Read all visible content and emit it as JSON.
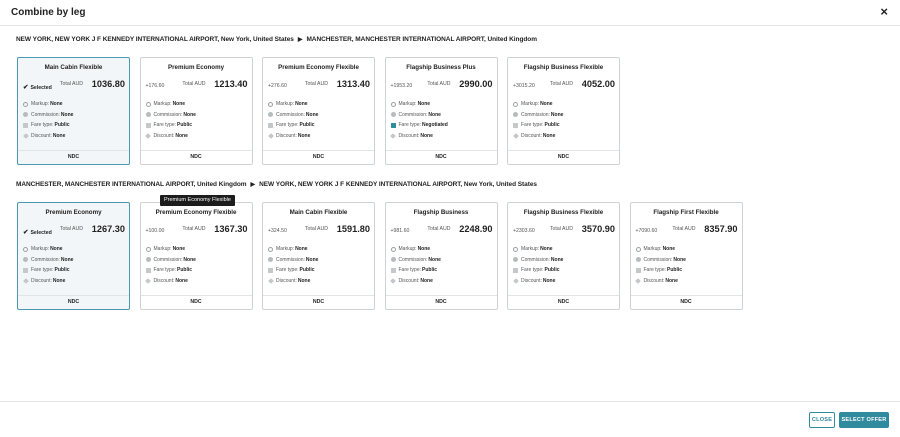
{
  "modal": {
    "title": "Combine by leg",
    "close_glyph": "×",
    "close_button": "CLOSE",
    "select_button": "SELECT OFFER"
  },
  "legs": [
    {
      "origin": "NEW YORK, NEW YORK J F KENNEDY INTERNATIONAL AIRPORT, New York, United States",
      "arrow": "▶",
      "destination": "MANCHESTER, MANCHESTER INTERNATIONAL AIRPORT, United Kingdom",
      "offers": [
        {
          "name": "Main Cabin Flexible",
          "selected": true,
          "diff": "Selected",
          "total_label": "Total AUD",
          "price": "1036.80",
          "markup_label": "Markup:",
          "markup": "None",
          "commission_label": "Commission:",
          "commission": "None",
          "fare_type_label": "Fare type:",
          "fare_type": "Public",
          "discount_label": "Discount:",
          "discount": "None",
          "source": "NDC",
          "negotiated": false
        },
        {
          "name": "Premium Economy",
          "selected": false,
          "diff": "+176.60",
          "total_label": "Total AUD",
          "price": "1213.40",
          "markup_label": "Markup:",
          "markup": "None",
          "commission_label": "Commission:",
          "commission": "None",
          "fare_type_label": "Fare type:",
          "fare_type": "Public",
          "discount_label": "Discount:",
          "discount": "None",
          "source": "NDC",
          "negotiated": false
        },
        {
          "name": "Premium Economy Flexible",
          "selected": false,
          "diff": "+276.60",
          "total_label": "Total AUD",
          "price": "1313.40",
          "markup_label": "Markup:",
          "markup": "None",
          "commission_label": "Commission:",
          "commission": "None",
          "fare_type_label": "Fare type:",
          "fare_type": "Public",
          "discount_label": "Discount:",
          "discount": "None",
          "source": "NDC",
          "negotiated": false
        },
        {
          "name": "Flagship Business Plus",
          "selected": false,
          "diff": "+1953.20",
          "total_label": "Total AUD",
          "price": "2990.00",
          "markup_label": "Markup:",
          "markup": "None",
          "commission_label": "Commission:",
          "commission": "None",
          "fare_type_label": "Fare type:",
          "fare_type": "Negotiated",
          "discount_label": "Discount:",
          "discount": "None",
          "source": "NDC",
          "negotiated": true
        },
        {
          "name": "Flagship Business Flexible",
          "selected": false,
          "diff": "+3015.20",
          "total_label": "Total AUD",
          "price": "4052.00",
          "markup_label": "Markup:",
          "markup": "None",
          "commission_label": "Commission:",
          "commission": "None",
          "fare_type_label": "Fare type:",
          "fare_type": "Public",
          "discount_label": "Discount:",
          "discount": "None",
          "source": "NDC",
          "negotiated": false
        }
      ]
    },
    {
      "origin": "MANCHESTER, MANCHESTER INTERNATIONAL AIRPORT, United Kingdom",
      "arrow": "▶",
      "destination": "NEW YORK, NEW YORK J F KENNEDY INTERNATIONAL AIRPORT, New York, United States",
      "offers": [
        {
          "name": "Premium Economy",
          "selected": true,
          "diff": "Selected",
          "total_label": "Total AUD",
          "price": "1267.30",
          "markup_label": "Markup:",
          "markup": "None",
          "commission_label": "Commission:",
          "commission": "None",
          "fare_type_label": "Fare type:",
          "fare_type": "Public",
          "discount_label": "Discount:",
          "discount": "None",
          "source": "NDC",
          "negotiated": false
        },
        {
          "name": "Premium Economy Flexible",
          "selected": false,
          "diff": "+100.00",
          "total_label": "Total AUD",
          "price": "1367.30",
          "markup_label": "Markup:",
          "markup": "None",
          "commission_label": "Commission:",
          "commission": "None",
          "fare_type_label": "Fare type:",
          "fare_type": "Public",
          "discount_label": "Discount:",
          "discount": "None",
          "source": "NDC",
          "negotiated": false
        },
        {
          "name": "Main Cabin Flexible",
          "selected": false,
          "diff": "+324.50",
          "total_label": "Total AUD",
          "price": "1591.80",
          "markup_label": "Markup:",
          "markup": "None",
          "commission_label": "Commission:",
          "commission": "None",
          "fare_type_label": "Fare type:",
          "fare_type": "Public",
          "discount_label": "Discount:",
          "discount": "None",
          "source": "NDC",
          "negotiated": false
        },
        {
          "name": "Flagship Business",
          "selected": false,
          "diff": "+981.60",
          "total_label": "Total AUD",
          "price": "2248.90",
          "markup_label": "Markup:",
          "markup": "None",
          "commission_label": "Commission:",
          "commission": "None",
          "fare_type_label": "Fare type:",
          "fare_type": "Public",
          "discount_label": "Discount:",
          "discount": "None",
          "source": "NDC",
          "negotiated": false
        },
        {
          "name": "Flagship Business Flexible",
          "selected": false,
          "diff": "+2303.60",
          "total_label": "Total AUD",
          "price": "3570.90",
          "markup_label": "Markup:",
          "markup": "None",
          "commission_label": "Commission:",
          "commission": "None",
          "fare_type_label": "Fare type:",
          "fare_type": "Public",
          "discount_label": "Discount:",
          "discount": "None",
          "source": "NDC",
          "negotiated": false
        },
        {
          "name": "Flagship First Flexible",
          "selected": false,
          "diff": "+7090.60",
          "total_label": "Total AUD",
          "price": "8357.90",
          "markup_label": "Markup:",
          "markup": "None",
          "commission_label": "Commission:",
          "commission": "None",
          "fare_type_label": "Fare type:",
          "fare_type": "Public",
          "discount_label": "Discount:",
          "discount": "None",
          "source": "NDC",
          "negotiated": false
        }
      ]
    }
  ],
  "tooltip": "Premium Economy Flexible",
  "colors": {
    "accent": "#2f8b9d",
    "selected_border": "#4a9bb0",
    "selected_bg": "#f3f6f8"
  }
}
